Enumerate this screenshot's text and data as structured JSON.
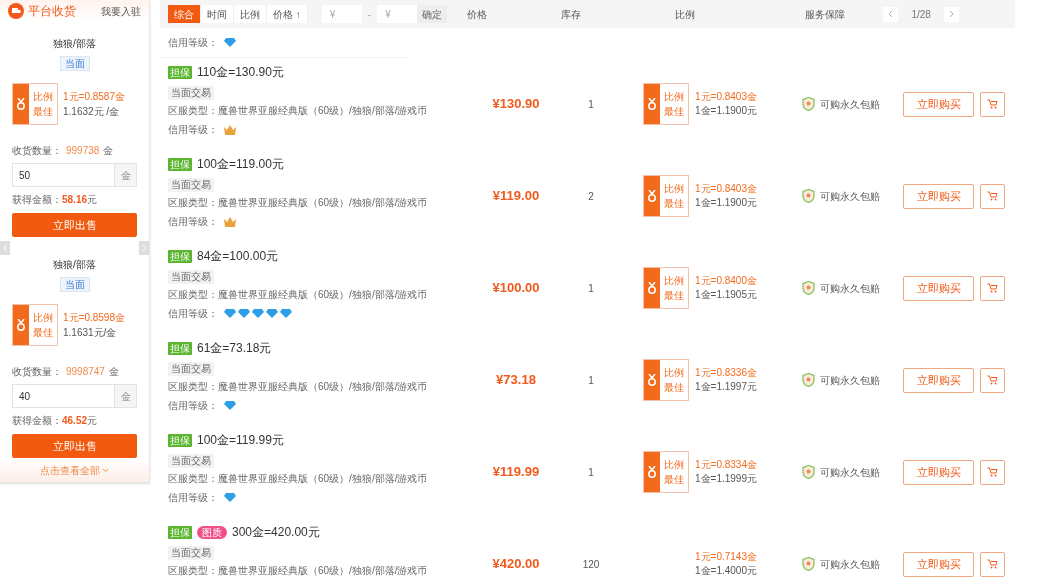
{
  "sidebar": {
    "title": "平台收货",
    "join_link": "我要入驻",
    "cards": [
      {
        "faction": "独狼/部落",
        "tag": "当面",
        "best_label": "比例最佳",
        "ratio_gold": "1元=0.8587金",
        "ratio_yuan": "1.1632元 /金",
        "qty_label": "收货数量：",
        "qty_value": "999738",
        "qty_unit": "金",
        "amount_input": "50",
        "input_unit": "金",
        "earn_label": "获得金额：",
        "earn_value": "58.16",
        "earn_unit": "元",
        "sell_button": "立即出售"
      },
      {
        "faction": "独狼/部落",
        "tag": "当面",
        "best_label": "比例最佳",
        "ratio_gold": "1元=0.8598金",
        "ratio_yuan": "1.1631元/金",
        "qty_label": "收货数量：",
        "qty_value": "9998747",
        "qty_unit": "金",
        "amount_input": "40",
        "input_unit": "金",
        "earn_label": "获得金额：",
        "earn_value": "46.52",
        "earn_unit": "元",
        "sell_button": "立即出售"
      }
    ],
    "view_all": "点击查看全部"
  },
  "toolbar": {
    "sort_tabs": [
      {
        "label": "综合",
        "selected": true
      },
      {
        "label": "时间",
        "selected": false
      },
      {
        "label": "比例",
        "selected": false
      },
      {
        "label": "价格 ↑",
        "selected": false
      }
    ],
    "min_price": {
      "placeholder": "¥"
    },
    "separator": "-",
    "max_price": {
      "placeholder": "¥"
    },
    "confirm": "确定",
    "columns": [
      "价格",
      "库存",
      "比例",
      "服务保障"
    ],
    "page": "1/28"
  },
  "partial_row": {
    "credit_label": "信用等级：",
    "credit": [
      {
        "kind": "diamond"
      }
    ]
  },
  "listings": [
    {
      "tags": [
        {
          "label": "担保",
          "kind": "guarantee"
        }
      ],
      "title": "110金=130.90元",
      "trade": "当面交易",
      "server": "区服类型：魔兽世界亚服经典版（60级）/独狼/部落/游戏币",
      "credit_label": "信用等级：",
      "credit": [
        {
          "kind": "crown"
        }
      ],
      "price": "¥130.90",
      "stock": "1",
      "best": true,
      "best_label": "比例最佳",
      "ratio_gold": "1元=0.8403金",
      "ratio_yuan": "1金=1.1900元",
      "service": "可购永久包赔",
      "buy": "立即购买"
    },
    {
      "tags": [
        {
          "label": "担保",
          "kind": "guarantee"
        }
      ],
      "title": "100金=119.00元",
      "trade": "当面交易",
      "server": "区服类型：魔兽世界亚服经典版（60级）/独狼/部落/游戏币",
      "credit_label": "信用等级：",
      "credit": [
        {
          "kind": "crown"
        }
      ],
      "price": "¥119.00",
      "stock": "2",
      "best": true,
      "best_label": "比例最佳",
      "ratio_gold": "1元=0.8403金",
      "ratio_yuan": "1金=1.1900元",
      "service": "可购永久包赔",
      "buy": "立即购买"
    },
    {
      "tags": [
        {
          "label": "担保",
          "kind": "guarantee"
        }
      ],
      "title": "84金=100.00元",
      "trade": "当面交易",
      "server": "区服类型：魔兽世界亚服经典版（60级）/独狼/部落/游戏币",
      "credit_label": "信用等级：",
      "credit": [
        {
          "kind": "diamond"
        },
        {
          "kind": "diamond"
        },
        {
          "kind": "diamond"
        },
        {
          "kind": "diamond"
        },
        {
          "kind": "diamond"
        }
      ],
      "price": "¥100.00",
      "stock": "1",
      "best": true,
      "best_label": "比例最佳",
      "ratio_gold": "1元=0.8400金",
      "ratio_yuan": "1金=1.1905元",
      "service": "可购永久包赔",
      "buy": "立即购买"
    },
    {
      "tags": [
        {
          "label": "担保",
          "kind": "guarantee"
        }
      ],
      "title": "61金=73.18元",
      "trade": "当面交易",
      "server": "区服类型：魔兽世界亚服经典版（60级）/独狼/部落/游戏币",
      "credit_label": "信用等级：",
      "credit": [
        {
          "kind": "diamond"
        }
      ],
      "price": "¥73.18",
      "stock": "1",
      "best": true,
      "best_label": "比例最佳",
      "ratio_gold": "1元=0.8336金",
      "ratio_yuan": "1金=1.1997元",
      "service": "可购永久包赔",
      "buy": "立即购买"
    },
    {
      "tags": [
        {
          "label": "担保",
          "kind": "guarantee"
        }
      ],
      "title": "100金=119.99元",
      "trade": "当面交易",
      "server": "区服类型：魔兽世界亚服经典版（60级）/独狼/部落/游戏币",
      "credit_label": "信用等级：",
      "credit": [
        {
          "kind": "diamond"
        }
      ],
      "price": "¥119.99",
      "stock": "1",
      "best": true,
      "best_label": "比例最佳",
      "ratio_gold": "1元=0.8334金",
      "ratio_yuan": "1金=1.1999元",
      "service": "可购永久包赔",
      "buy": "立即购买"
    },
    {
      "tags": [
        {
          "label": "担保",
          "kind": "guarantee"
        },
        {
          "label": "图质",
          "kind": "promo"
        }
      ],
      "title": "300金=420.00元",
      "trade": "当面交易",
      "server": "区服类型：魔兽世界亚服经典版（60级）/独狼/部落/游戏币",
      "price": "¥420.00",
      "stock": "120",
      "best": false,
      "ratio_gold": "1元=0.7143金",
      "ratio_yuan": "1金=1.4000元",
      "service": "可购永久包赔",
      "buy": "立即购买"
    }
  ]
}
